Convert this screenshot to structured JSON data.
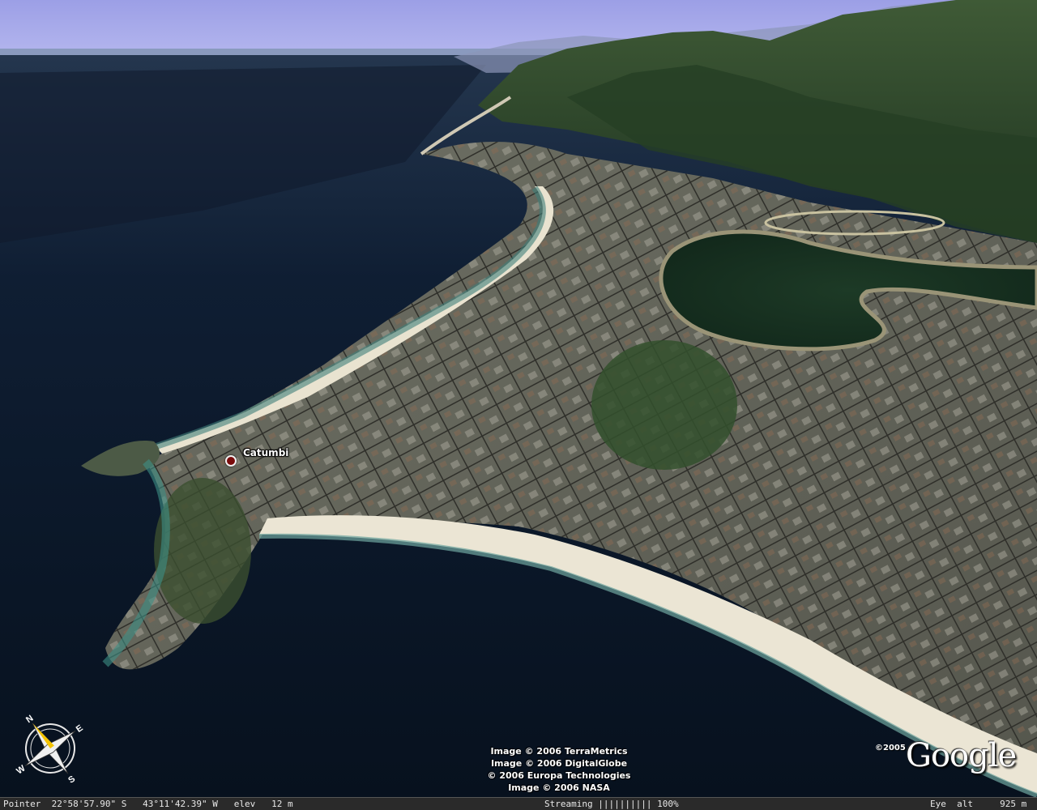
{
  "placemark": {
    "label": "Catumbi",
    "icon": "placemark-circle-icon"
  },
  "credits": [
    "Image © 2006 TerraMetrics",
    "Image © 2006 DigitalGlobe",
    "© 2006 Europa Technologies",
    "Image © 2006 NASA"
  ],
  "logo": {
    "copyright": "©2005",
    "text": "Google"
  },
  "compass": {
    "icon": "compass-rose-icon",
    "letters": [
      "N",
      "E",
      "S",
      "W"
    ]
  },
  "status": {
    "pointer": "Pointer  22°58'57.90\" S   43°11'42.39\" W   elev   12 m",
    "streaming": "Streaming |||||||||| 100%",
    "eye_alt": "Eye  alt     925 m"
  },
  "colors": {
    "sky": "#a4a6e6",
    "ocean": "#0b1626",
    "mountain": "#2e4a2a",
    "city": "#6a6a60",
    "beach": "#e8e2d2"
  }
}
